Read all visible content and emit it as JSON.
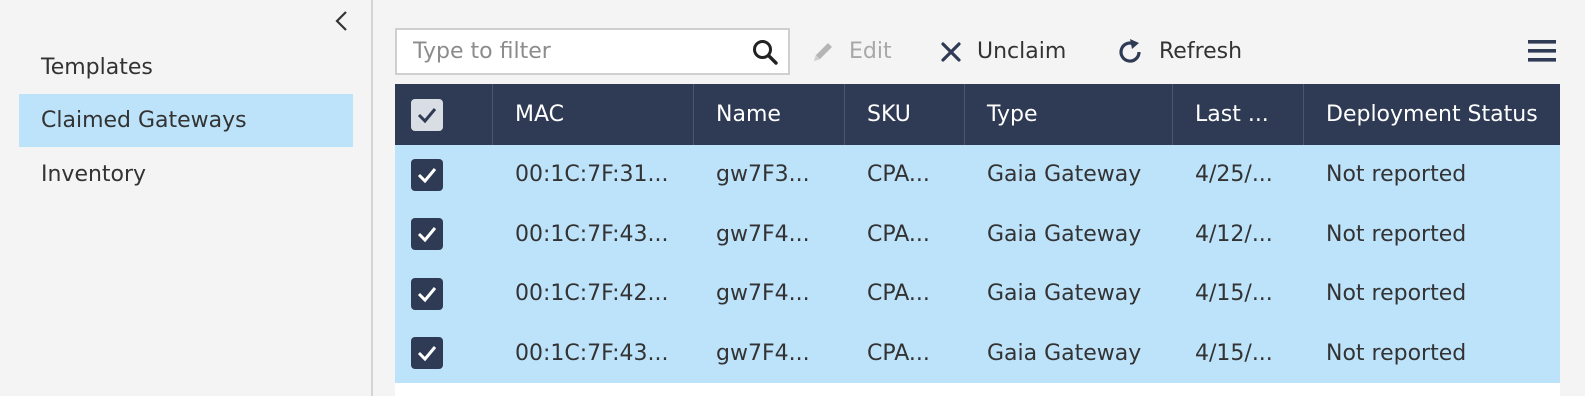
{
  "sidebar": {
    "items": [
      {
        "label": "Templates",
        "active": false
      },
      {
        "label": "Claimed Gateways",
        "active": true
      },
      {
        "label": "Inventory",
        "active": false
      }
    ]
  },
  "toolbar": {
    "filter_placeholder": "Type to filter",
    "filter_value": "",
    "edit_label": "Edit",
    "unclaim_label": "Unclaim",
    "refresh_label": "Refresh"
  },
  "table": {
    "headers": [
      "MAC",
      "Name",
      "SKU",
      "Type",
      "Last ...",
      "Deployment Status"
    ],
    "header_all_checked": true,
    "rows": [
      {
        "checked": true,
        "mac": "00:1C:7F:31...",
        "name": "gw7F3...",
        "sku": "CPA...",
        "type": "Gaia Gateway",
        "last": "4/25/...",
        "status": "Not reported"
      },
      {
        "checked": true,
        "mac": "00:1C:7F:43...",
        "name": "gw7F4...",
        "sku": "CPA...",
        "type": "Gaia Gateway",
        "last": "4/12/...",
        "status": "Not reported"
      },
      {
        "checked": true,
        "mac": "00:1C:7F:42...",
        "name": "gw7F4...",
        "sku": "CPA...",
        "type": "Gaia Gateway",
        "last": "4/15/...",
        "status": "Not reported"
      },
      {
        "checked": true,
        "mac": "00:1C:7F:43...",
        "name": "gw7F4...",
        "sku": "CPA...",
        "type": "Gaia Gateway",
        "last": "4/15/...",
        "status": "Not reported"
      }
    ]
  },
  "colors": {
    "header_bg": "#2f3b54",
    "selected_row_bg": "#bde3fb",
    "active_nav_bg": "#bde3fb"
  },
  "icons": {
    "collapse": "chevron-left-icon",
    "search": "search-icon",
    "edit": "pencil-icon",
    "unclaim": "close-icon",
    "refresh": "refresh-icon",
    "menu": "hamburger-menu-icon"
  }
}
